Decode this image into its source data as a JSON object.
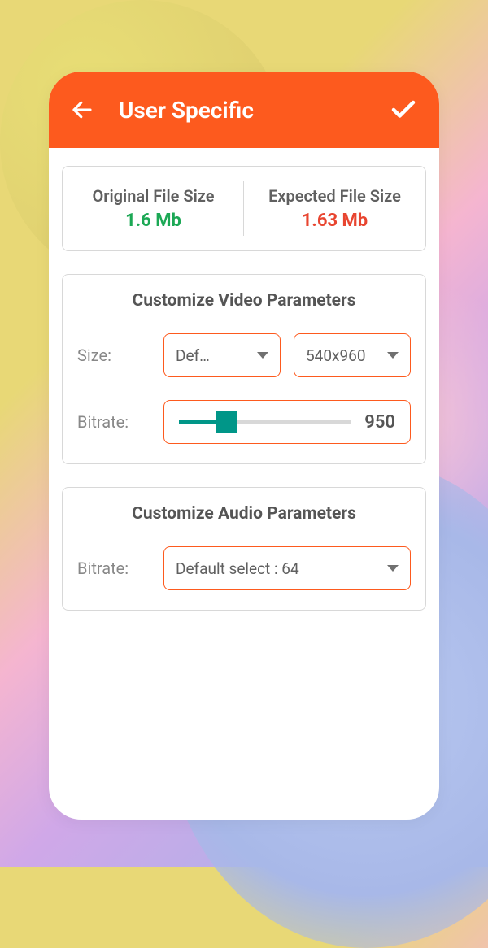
{
  "header": {
    "title": "User Specific"
  },
  "fileSize": {
    "originalLabel": "Original File Size",
    "originalValue": "1.6 Mb",
    "expectedLabel": "Expected File Size",
    "expectedValue": "1.63 Mb"
  },
  "video": {
    "title": "Customize Video Parameters",
    "sizeLabel": "Size:",
    "sizeSelect1": "Def…",
    "sizeSelect2": "540x960",
    "bitrateLabel": "Bitrate:",
    "bitrateValue": "950"
  },
  "audio": {
    "title": "Customize Audio Parameters",
    "bitrateLabel": "Bitrate:",
    "bitrateSelect": "Default select : 64"
  }
}
